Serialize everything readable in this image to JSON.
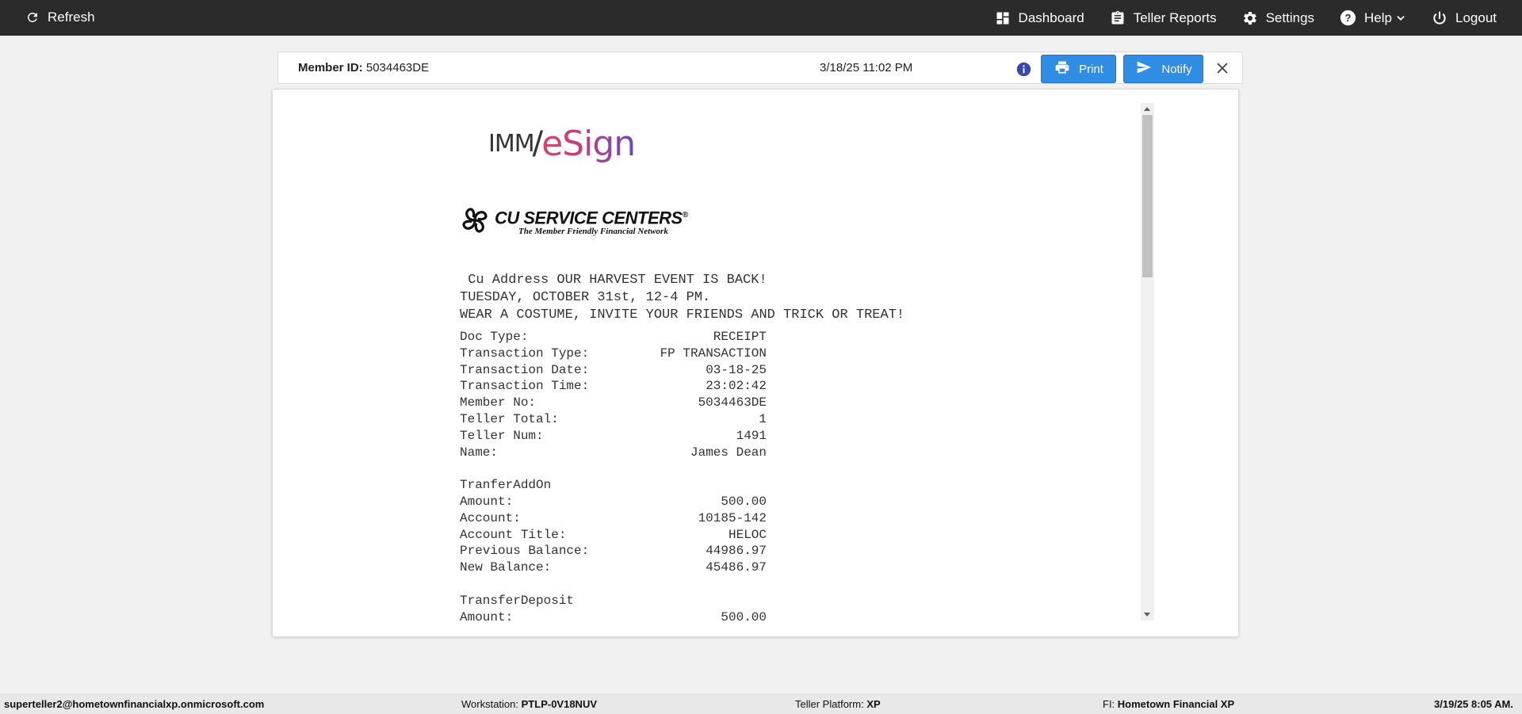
{
  "topbar": {
    "refresh_label": "Refresh",
    "dashboard_label": "Dashboard",
    "teller_reports_label": "Teller Reports",
    "settings_label": "Settings",
    "help_label": "Help",
    "logout_label": "Logout"
  },
  "doc_header": {
    "member_id_label": "Member ID:",
    "member_id_value": "5034463DE",
    "datetime": "3/18/25 11:02 PM",
    "print_label": "Print",
    "notify_label": "Notify"
  },
  "document": {
    "logo_imm": "IMM",
    "logo_esign": "eSign",
    "cu_logo_main": "CU SERVICE CENTERS",
    "cu_logo_reg": "®",
    "cu_logo_sub": "The Member Friendly Financial Network",
    "message_lines": [
      " Cu Address OUR HARVEST EVENT IS BACK!",
      "TUESDAY, OCTOBER 31st, 12-4 PM.",
      "WEAR A COSTUME, INVITE YOUR FRIENDS AND TRICK OR TREAT!"
    ],
    "fields": [
      {
        "label": "Doc Type:",
        "value": "RECEIPT"
      },
      {
        "label": "Transaction Type:",
        "value": "FP TRANSACTION"
      },
      {
        "label": "Transaction Date:",
        "value": "03-18-25"
      },
      {
        "label": "Transaction Time:",
        "value": "23:02:42"
      },
      {
        "label": "Member No:",
        "value": "5034463DE"
      },
      {
        "label": "Teller Total:",
        "value": "1"
      },
      {
        "label": "Teller Num:",
        "value": "1491"
      },
      {
        "label": "Name:",
        "value": "James Dean"
      }
    ],
    "section1_title": "TranferAddOn",
    "section1_fields": [
      {
        "label": "Amount:",
        "value": "500.00"
      },
      {
        "label": "Account:",
        "value": "10185-142"
      },
      {
        "label": "Account Title:",
        "value": "HELOC"
      },
      {
        "label": "Previous Balance:",
        "value": "44986.97"
      },
      {
        "label": "New Balance:",
        "value": "45486.97"
      }
    ],
    "section2_title": "TransferDeposit",
    "section2_fields": [
      {
        "label": "Amount:",
        "value": "500.00"
      }
    ]
  },
  "statusbar": {
    "user": "superteller2@hometownfinancialxp.onmicrosoft.com",
    "workstation_label": "Workstation:",
    "workstation_value": "PTLP-0V18NUV",
    "platform_label": "Teller Platform:",
    "platform_value": "XP",
    "fi_label": "FI:",
    "fi_value": "Hometown Financial XP",
    "datetime": "3/19/25 8:05 AM."
  },
  "colors": {
    "topbar_bg": "#2b2b2b",
    "button_blue": "#2f8de4",
    "info_icon": "#3949ab"
  }
}
